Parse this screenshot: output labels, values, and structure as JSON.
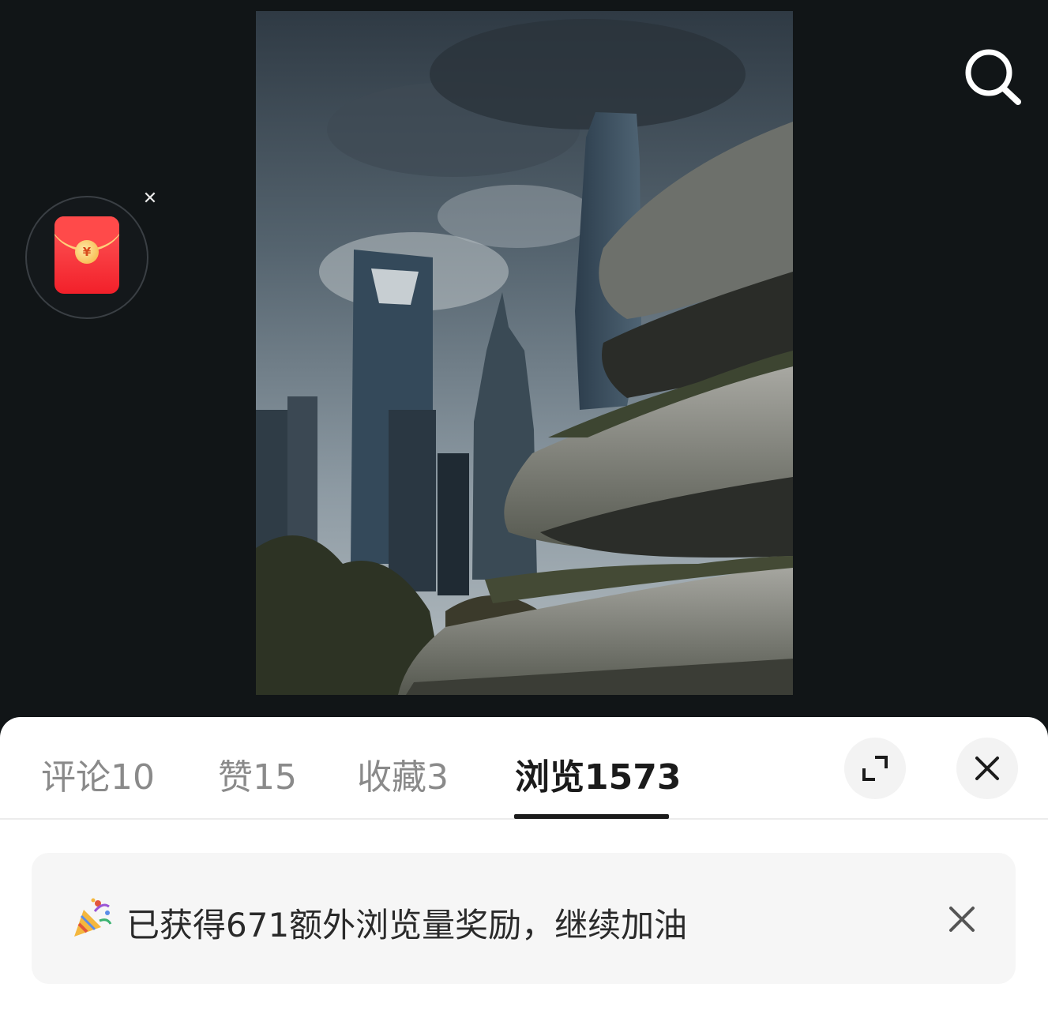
{
  "tabs": [
    {
      "label": "评论",
      "count": "10"
    },
    {
      "label": "赞",
      "count": "15"
    },
    {
      "label": "收藏",
      "count": "3"
    },
    {
      "label": "浏览",
      "count": "1573"
    }
  ],
  "active_tab": "浏览",
  "red_packet": {
    "coin_symbol": "¥"
  },
  "notice": {
    "text": "已获得671额外浏览量奖励，继续加油"
  },
  "icons": {
    "search": "search-icon",
    "expand": "expand-icon",
    "close": "close-icon",
    "party": "party-popper-icon",
    "red_packet": "red-envelope-icon"
  },
  "colors": {
    "active_tab_text": "#1b1b1b",
    "inactive_tab_text": "#8a8a8a",
    "red_packet": "#f2202a"
  }
}
